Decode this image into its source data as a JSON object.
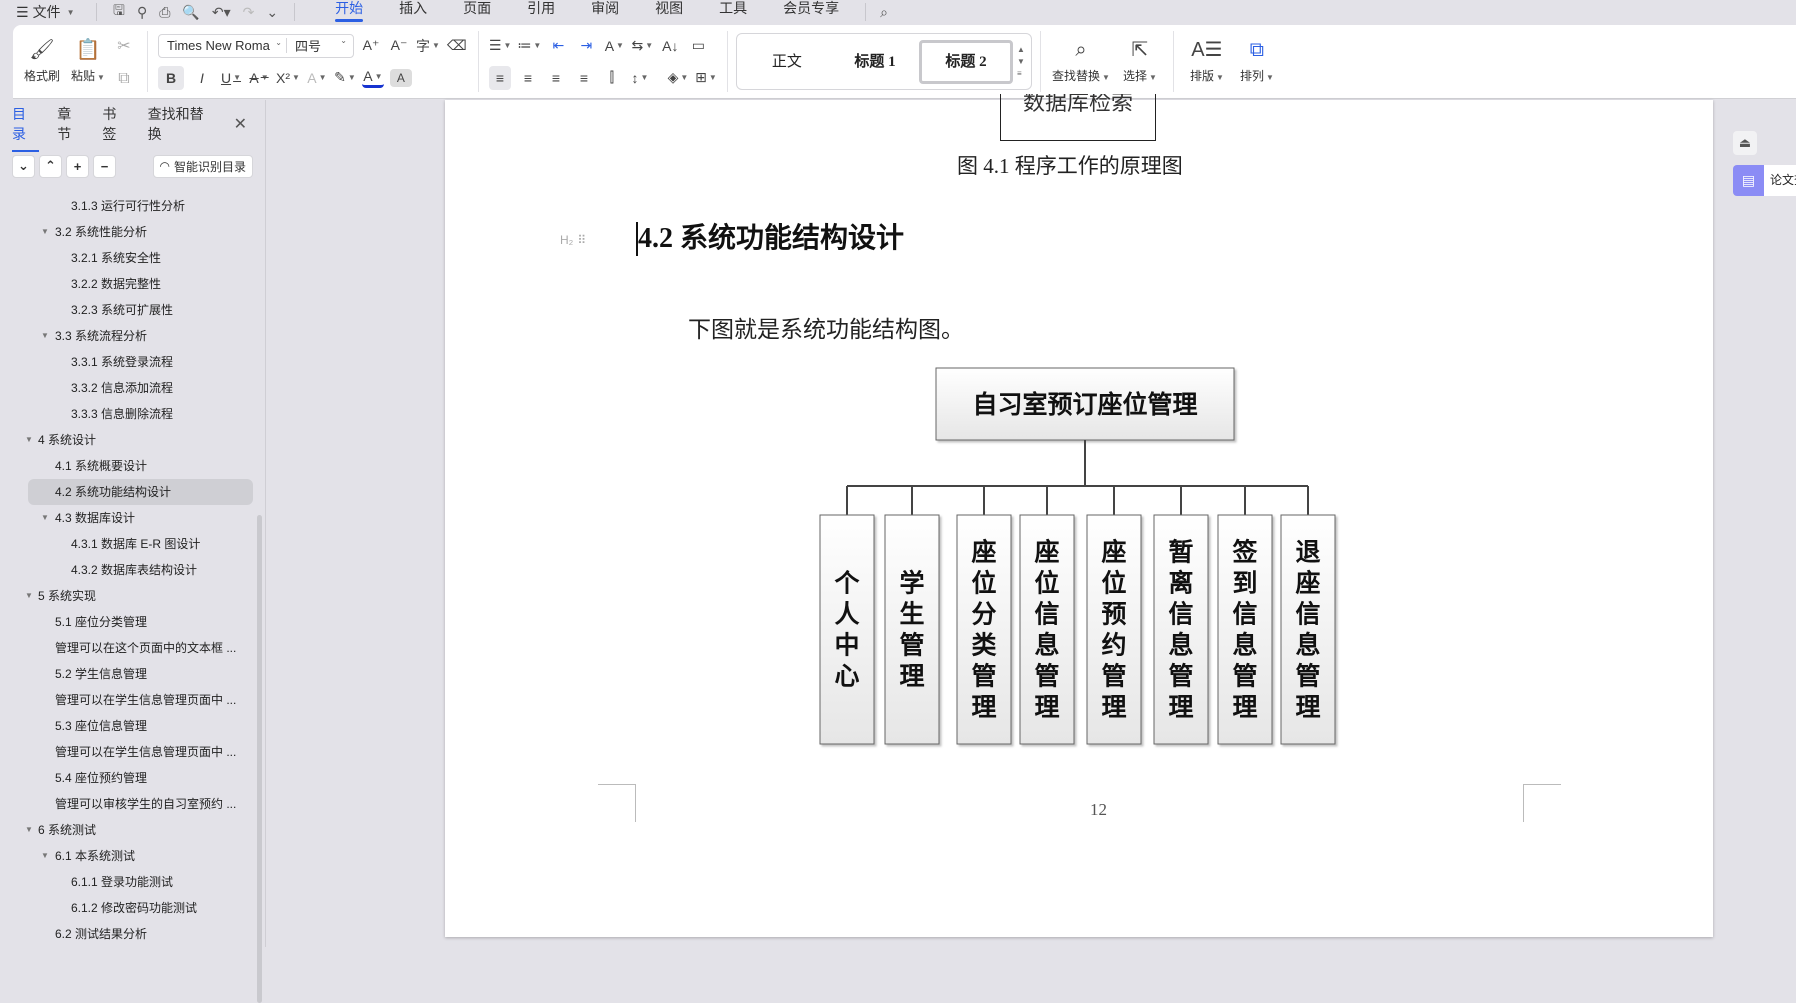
{
  "menubar": {
    "file_label": "文件",
    "tabs": [
      "开始",
      "插入",
      "页面",
      "引用",
      "审阅",
      "视图",
      "工具",
      "会员专享"
    ],
    "active_tab": "开始"
  },
  "ribbon": {
    "format_painter": "格式刷",
    "paste": "粘贴",
    "font_name": "Times New Roma",
    "font_size": "四号",
    "styles": [
      "正文",
      "标题 1",
      "标题 2"
    ],
    "find_replace": "查找替换",
    "select": "选择",
    "layout": "排版",
    "arrange": "排列",
    "bold": "B",
    "italic": "I",
    "underline": "U"
  },
  "sidebar": {
    "tabs": [
      "目录",
      "章节",
      "书签",
      "查找和替换"
    ],
    "active_tab": "目录",
    "smart_toc_label": "智能识别目录",
    "toc": [
      {
        "level": 3,
        "label": "3.1.3  运行可行性分析",
        "expandable": false
      },
      {
        "level": 2,
        "label": "3.2 系统性能分析",
        "expandable": true
      },
      {
        "level": 3,
        "label": "3.2.1  系统安全性",
        "expandable": false
      },
      {
        "level": 3,
        "label": "3.2.2  数据完整性",
        "expandable": false
      },
      {
        "level": 3,
        "label": "3.2.3 系统可扩展性",
        "expandable": false
      },
      {
        "level": 2,
        "label": "3.3 系统流程分析",
        "expandable": true
      },
      {
        "level": 3,
        "label": "3.3.1 系统登录流程",
        "expandable": false
      },
      {
        "level": 3,
        "label": "3.3.2 信息添加流程",
        "expandable": false
      },
      {
        "level": 3,
        "label": "3.3.3 信息删除流程",
        "expandable": false
      },
      {
        "level": 1,
        "label": "4  系统设计",
        "expandable": true
      },
      {
        "level": 2,
        "label": "4.1 系统概要设计",
        "expandable": false
      },
      {
        "level": 2,
        "label": "4.2 系统功能结构设计",
        "expandable": false,
        "active": true
      },
      {
        "level": 2,
        "label": "4.3 数据库设计",
        "expandable": true
      },
      {
        "level": 3,
        "label": "4.3.1 数据库 E-R 图设计",
        "expandable": false
      },
      {
        "level": 3,
        "label": "4.3.2  数据库表结构设计",
        "expandable": false
      },
      {
        "level": 1,
        "label": "5  系统实现",
        "expandable": true
      },
      {
        "level": 2,
        "label": "5.1  座位分类管理",
        "expandable": false
      },
      {
        "level": 2,
        "label": "管理可以在这个页面中的文本框 ...",
        "expandable": false
      },
      {
        "level": 2,
        "label": "5.2  学生信息管理",
        "expandable": false
      },
      {
        "level": 2,
        "label": "管理可以在学生信息管理页面中 ...",
        "expandable": false
      },
      {
        "level": 2,
        "label": "5.3  座位信息管理",
        "expandable": false
      },
      {
        "level": 2,
        "label": "管理可以在学生信息管理页面中 ...",
        "expandable": false
      },
      {
        "level": 2,
        "label": "5.4  座位预约管理",
        "expandable": false
      },
      {
        "level": 2,
        "label": "管理可以审核学生的自习室预约 ...",
        "expandable": false
      },
      {
        "level": 1,
        "label": "6 系统测试",
        "expandable": true
      },
      {
        "level": 2,
        "label": "6.1  本系统测试",
        "expandable": true
      },
      {
        "level": 3,
        "label": "6.1.1 登录功能测试",
        "expandable": false
      },
      {
        "level": 3,
        "label": "6.1.2 修改密码功能测试",
        "expandable": false
      },
      {
        "level": 2,
        "label": "6.2 测试结果分析",
        "expandable": false
      }
    ]
  },
  "document": {
    "prev_box_text": "数据库检索",
    "prev_caption": "图 4.1  程序工作的原理图",
    "heading_marker": "H₂",
    "heading": "4.2 系统功能结构设计",
    "paragraph": "下图就是系统功能结构图。",
    "page_number": "12",
    "diagram": {
      "root": "自习室预订座位管理",
      "children": [
        "个人中心",
        "学生管理",
        "座位分类管理",
        "座位信息管理",
        "座位预约管理",
        "暂离信息管理",
        "签到信息管理",
        "退座信息管理"
      ]
    }
  },
  "right_panel": {
    "paper_label": "论文查重"
  },
  "colors": {
    "accent": "#2b5fe3",
    "paper_btn": "#8b8cf5",
    "chrome_bg": "#e3e2e8"
  }
}
